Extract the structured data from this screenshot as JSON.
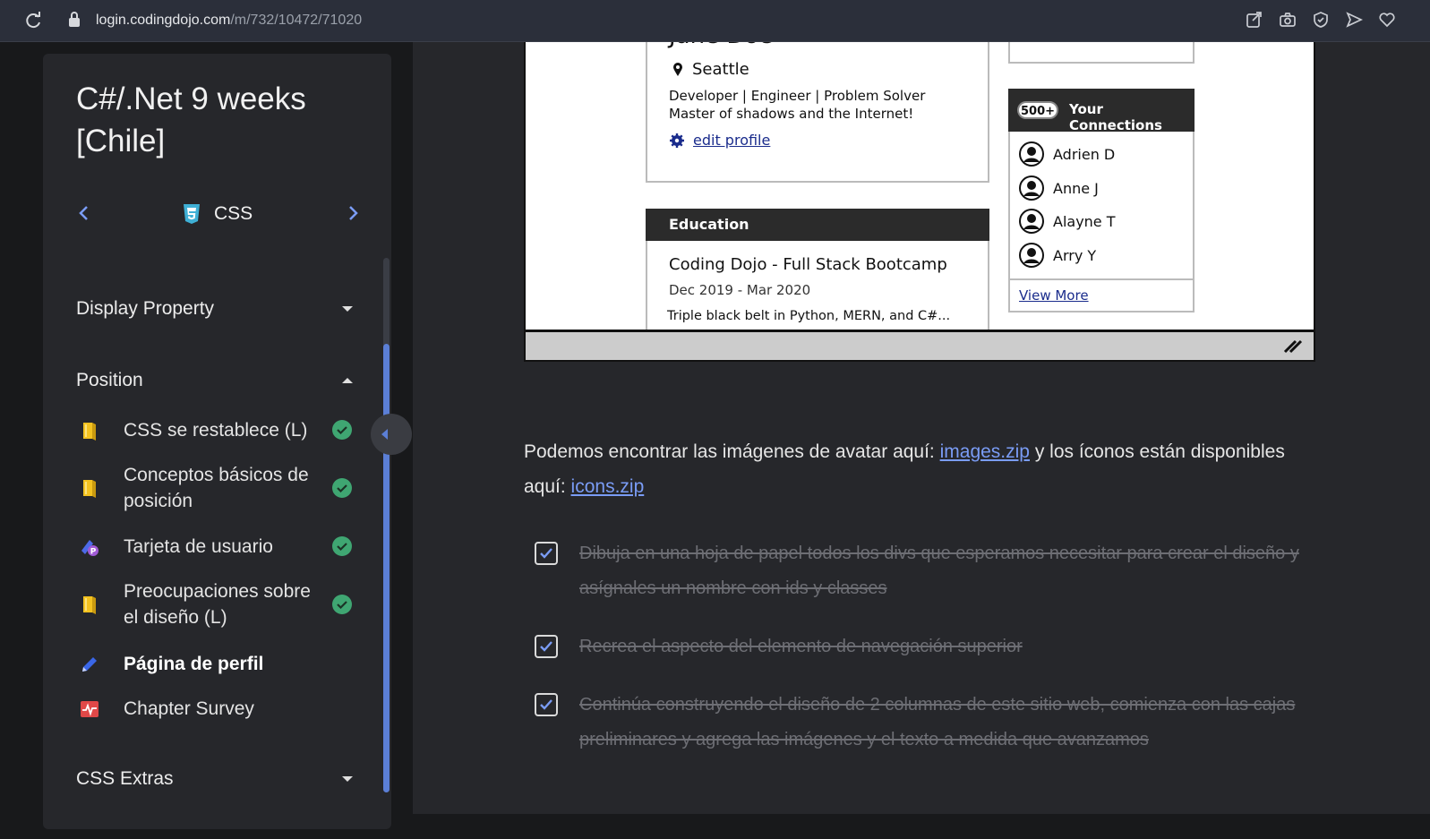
{
  "browser": {
    "url_domain": "login.codingdojo.com",
    "url_path": "/m/732/10472/71020",
    "extension_icons": [
      "share-icon",
      "camera-icon",
      "shield-check-icon",
      "send-icon",
      "heart-icon"
    ]
  },
  "sidebar": {
    "course_title": "C#/.Net 9 weeks [Chile]",
    "chapter_label": "CSS",
    "sections": [
      {
        "title": "Display Property",
        "state": "collapsed"
      },
      {
        "title": "Position",
        "state": "expanded"
      },
      {
        "title": "CSS Extras",
        "state": "collapsed"
      }
    ],
    "lessons": [
      {
        "label": "CSS se restablece (L)",
        "icon": "book-icon",
        "completed": true
      },
      {
        "label": "Conceptos básicos de posición",
        "icon": "book-icon",
        "completed": true
      },
      {
        "label": "Tarjeta de usuario",
        "icon": "project-icon",
        "completed": true
      },
      {
        "label": "Preocupaciones sobre el diseño (L)",
        "icon": "book-icon",
        "completed": true
      },
      {
        "label": "Página de perfil",
        "icon": "pencil-icon",
        "completed": false,
        "active": true
      },
      {
        "label": "Chapter Survey",
        "icon": "survey-icon",
        "completed": false
      }
    ]
  },
  "wireframe": {
    "name": "Jane Doe",
    "location": "Seattle",
    "bio_line1": "Developer | Engineer | Problem Solver",
    "bio_line2": "Master of shadows and the Internet!",
    "edit_link": "edit profile",
    "education_header": "Education",
    "education_title": "Coding Dojo - Full Stack Bootcamp",
    "education_dates": "Dec 2019 - Mar 2020",
    "education_desc": "Triple black belt in Python, MERN, and C#...",
    "connections_badge": "500+",
    "connections_title": "Your Connections",
    "connections": [
      "Adrien D",
      "Anne J",
      "Alayne T",
      "Arry Y"
    ],
    "view_more": "View More"
  },
  "content": {
    "para_before": "Podemos encontrar las imágenes de avatar aquí: ",
    "images_link": "images.zip",
    "para_middle": " y los íconos están disponibles aquí: ",
    "icons_link": "icons.zip",
    "tasks": [
      {
        "text": "Dibuja en una hoja de papel todos los divs que esperamos necesitar para crear el diseño y asígnales un nombre con ids y classes",
        "checked": true
      },
      {
        "text": "Recrea el aspecto del elemento de navegación superior",
        "checked": true
      },
      {
        "text": "Continúa construyendo el diseño de 2 columnas de este sitio web, comienza con las cajas preliminares y agrega las imágenes y el texto a medida que avanzamos",
        "checked": true
      }
    ]
  },
  "colors": {
    "link": "#7a9cf5",
    "completed_check": "#3fa672",
    "scroll_thumb": "#5b7fd6"
  }
}
